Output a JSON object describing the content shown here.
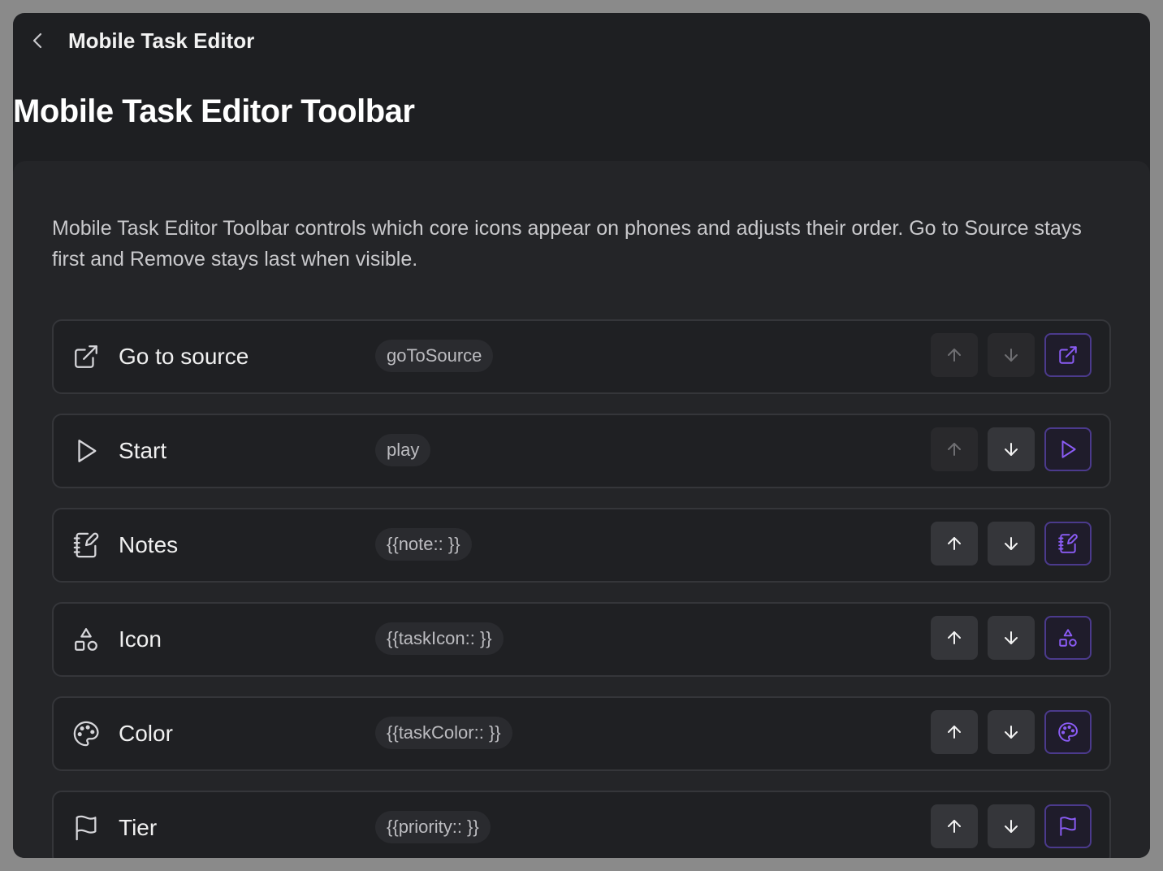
{
  "topbar": {
    "title": "Mobile Task Editor",
    "back_icon": "chevron-left-icon"
  },
  "page_title": "Mobile Task Editor Toolbar",
  "description": "Mobile Task Editor Toolbar controls which core icons appear on phones and adjusts their order. Go to Source stays first and Remove stays last when visible.",
  "colors": {
    "background": "#1e1f22",
    "panel": "#242528",
    "accent": "#8b5cf6",
    "text": "#f0f0f0",
    "muted_text": "#bcbcc0"
  },
  "items": [
    {
      "label": "Go to source",
      "code": "goToSource",
      "icon": "external-link-icon",
      "up_enabled": false,
      "down_enabled": false,
      "visible": true
    },
    {
      "label": "Start",
      "code": "play",
      "icon": "play-icon",
      "up_enabled": false,
      "down_enabled": true,
      "visible": true
    },
    {
      "label": "Notes",
      "code": "{{note:: }}",
      "icon": "notebook-pen-icon",
      "up_enabled": true,
      "down_enabled": true,
      "visible": true
    },
    {
      "label": "Icon",
      "code": "{{taskIcon:: }}",
      "icon": "shapes-icon",
      "up_enabled": true,
      "down_enabled": true,
      "visible": true
    },
    {
      "label": "Color",
      "code": "{{taskColor:: }}",
      "icon": "palette-icon",
      "up_enabled": true,
      "down_enabled": true,
      "visible": true
    },
    {
      "label": "Tier",
      "code": "{{priority:: }}",
      "icon": "flag-icon",
      "up_enabled": true,
      "down_enabled": true,
      "visible": true
    }
  ]
}
